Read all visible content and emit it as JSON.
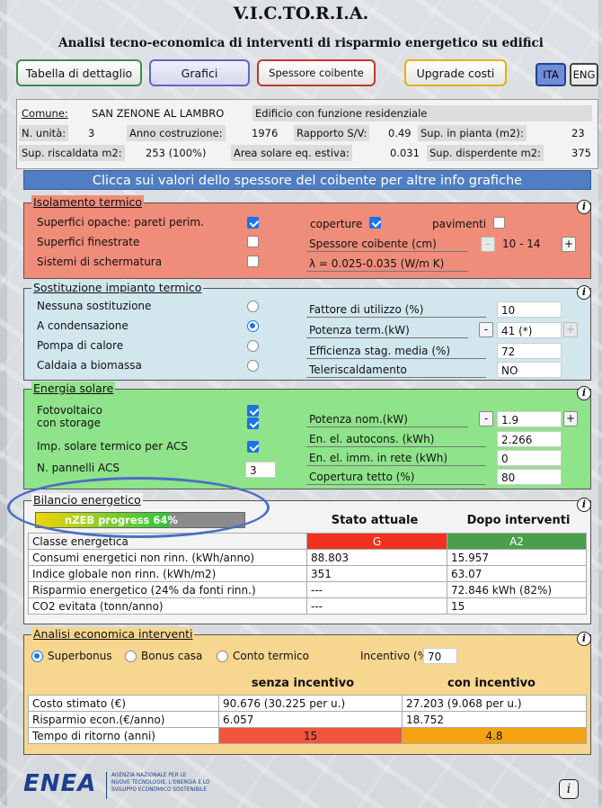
{
  "header": {
    "title": "V.I.C.TO.R.I.A.",
    "subtitle": "Analisi tecno-economica di interventi di risparmio energetico su edifici"
  },
  "toolbar": {
    "tabella": "Tabella di dettaglio",
    "grafici": "Grafici",
    "spessore": "Spessore coibente",
    "upgrade": "Upgrade costi",
    "ita": "ITA",
    "eng": "ENG"
  },
  "building": {
    "comune_label": "Comune:",
    "comune_value": "SAN ZENONE AL LAMBRO",
    "funzione": "Edificio con funzione residenziale",
    "unita_label": "N. unità:",
    "unita_value": "3",
    "anno_label": "Anno costruzione:",
    "anno_value": "1976",
    "sv_label": "Rapporto S/V:",
    "sv_value": "0.49",
    "pianta_label": "Sup. in pianta (m2):",
    "pianta_value": "23",
    "risc_label": "Sup. riscaldata m2:",
    "risc_value": "253 (100%)",
    "area_label": "Area solare eq. estiva:",
    "area_value": "0.031",
    "disp_label": "Sup. disperdente m2:",
    "disp_value": "375"
  },
  "banner": "Clicca sui valori dello spessore del coibente per altre info grafiche",
  "isolamento": {
    "title": "Isolamento termico",
    "pareti": "Superfici opache: pareti perim.",
    "finestrate": "Superfici finestrate",
    "schermatura": "Sistemi di schermatura",
    "coperture": "coperture",
    "pavimenti": "pavimenti",
    "spessore_label": "Spessore coibente (cm)",
    "spessore_value": "10 - 14",
    "lambda": "λ = 0.025-0.035 (W/m K)",
    "minus": "-",
    "plus": "+"
  },
  "sostituzione": {
    "title": "Sostituzione impianto termico",
    "options": [
      "Nessuna sostituzione",
      "A condensazione",
      "Pompa di calore",
      "Caldaia a biomassa"
    ],
    "selected": "A condensazione",
    "fattore_label": "Fattore di utilizzo (%)",
    "fattore_value": "10",
    "potenza_label": "Potenza term.(kW)",
    "potenza_value": "41 (*)",
    "efficienza_label": "Efficienza stag. media (%)",
    "efficienza_value": "72",
    "teleris_label": "Teleriscaldamento",
    "teleris_value": "NO",
    "minus": "-",
    "plus": "+"
  },
  "solare": {
    "title": "Energia solare",
    "fotovoltaico": "Fotovoltaico",
    "storage": "con storage",
    "acs": "Imp. solare termico per ACS",
    "pannelli_label": "N. pannelli ACS",
    "pannelli_value": "3",
    "potenza_label": "Potenza nom.(kW)",
    "potenza_value": "1.9",
    "autocons_label": "En. el. autocons. (kWh)",
    "autocons_value": "2.266",
    "rete_label": "En. el. imm. in rete (kWh)",
    "rete_value": "0",
    "copertura_label": "Copertura tetto (%)",
    "copertura_value": "80",
    "minus": "-",
    "plus": "+"
  },
  "bilancio": {
    "title": "Bilancio energetico",
    "progress_label": "nZEB progress 64%",
    "progress_fraction": 0.64,
    "col_attuale": "Stato attuale",
    "col_dopo": "Dopo interventi",
    "rows": [
      {
        "label": "Classe energetica",
        "attuale": "G",
        "dopo": "A2"
      },
      {
        "label": "Consumi energetici non rinn. (kWh/anno)",
        "attuale": "88.803",
        "dopo": "15.957"
      },
      {
        "label": "Indice globale non rinn. (kWh/m2)",
        "attuale": "351",
        "dopo": "63.07"
      },
      {
        "label": "Risparmio energetico (24% da fonti rinn.)",
        "attuale": "---",
        "dopo": "72.846 kWh (82%)"
      },
      {
        "label": "CO2 evitata (tonn/anno)",
        "attuale": "---",
        "dopo": "15"
      }
    ],
    "class_colors": {
      "G": "#f0321e",
      "A2": "#4aa04a"
    }
  },
  "economica": {
    "title": "Analisi economica interventi",
    "options": [
      "Superbonus",
      "Bonus casa",
      "Conto termico"
    ],
    "selected": "Superbonus",
    "incentivo_label": "Incentivo (%)",
    "incentivo_value": "70",
    "col_senza": "senza incentivo",
    "col_con": "con incentivo",
    "rows": [
      {
        "label": "Costo stimato (€)",
        "senza": "90.676 (30.225 per u.)",
        "con": "27.203 (9.068 per u.)"
      },
      {
        "label": "Risparmio econ.(€/anno)",
        "senza": "6.057",
        "con": "18.752"
      },
      {
        "label": "Tempo di ritorno (anni)",
        "senza": "15",
        "con": "4.8"
      }
    ],
    "ritorno_colors": {
      "senza": "#f2553e",
      "con": "#f5a212"
    }
  },
  "footer": {
    "logo": "ENEA",
    "agency_line1": "AGENZIA NAZIONALE PER LE",
    "agency_line2": "NUOVE TECNOLOGIE, L'ENERGIA E LO",
    "agency_line3": "SVILUPPO ECONOMICO SOSTENIBILE",
    "info": "i"
  }
}
